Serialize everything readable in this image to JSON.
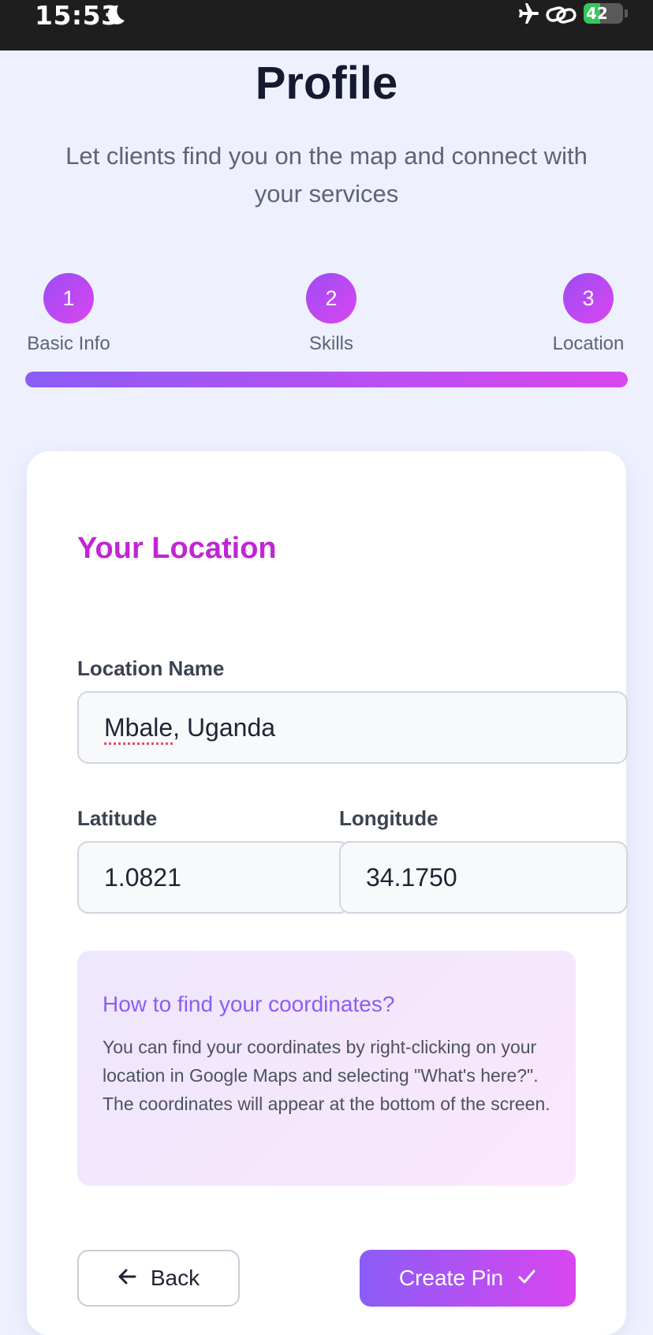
{
  "status_bar": {
    "time": "15:53",
    "battery_level": "42",
    "icons": [
      "moon-icon",
      "airplane-icon",
      "link-icon",
      "battery-icon"
    ]
  },
  "header": {
    "title": "Profile",
    "subtitle": "Let clients find you on the map and connect with your services"
  },
  "stepper": {
    "steps": [
      {
        "number": "1",
        "label": "Basic Info"
      },
      {
        "number": "2",
        "label": "Skills"
      },
      {
        "number": "3",
        "label": "Location"
      }
    ],
    "progress_percent": 100,
    "colors": {
      "gradient_start": "#8b5cf6",
      "gradient_end": "#d946ef"
    }
  },
  "form": {
    "title": "Your Location",
    "location_name": {
      "label": "Location Name",
      "value": "Mbale, Uganda"
    },
    "latitude": {
      "label": "Latitude",
      "value": "1.0821"
    },
    "longitude": {
      "label": "Longitude",
      "value": "34.1750"
    },
    "help": {
      "title": "How to find your coordinates?",
      "text": "You can find your coordinates by right-clicking on your location in Google Maps and selecting \"What's here?\". The coordinates will appear at the bottom of the screen."
    },
    "back_label": "Back",
    "submit_label": "Create Pin"
  },
  "colors": {
    "accent": "#c026d3",
    "help_title": "#8b5cf6",
    "heading": "#151a30"
  }
}
